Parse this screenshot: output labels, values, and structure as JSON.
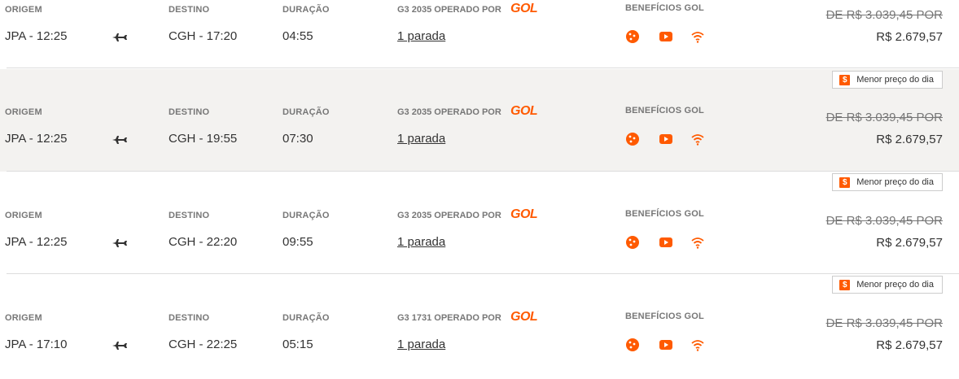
{
  "labels": {
    "origin": "ORIGEM",
    "destination": "DESTINO",
    "duration": "DURAÇÃO",
    "operated_by": "OPERADO POR",
    "benefits": "BENEFÍCIOS GOL",
    "carrier_logo": "GOL"
  },
  "colors": {
    "accent": "#ff5a00",
    "alt_row_bg": "#f3f2f0"
  },
  "icons": [
    "cookie-icon",
    "youtube-icon",
    "wifi-icon",
    "plane-icon",
    "dollar-icon"
  ],
  "flights": [
    {
      "origin": "JPA - 12:25",
      "destination": "CGH - 17:20",
      "duration": "04:55",
      "flight_number": "G3 2035",
      "stops": "1 parada",
      "old_price": "DE R$ 3.039,45 POR",
      "price": "R$ 2.679,57",
      "badge": ""
    },
    {
      "origin": "JPA - 12:25",
      "destination": "CGH - 19:55",
      "duration": "07:30",
      "flight_number": "G3 2035",
      "stops": "1 parada",
      "old_price": "DE R$ 3.039,45 POR",
      "price": "R$ 2.679,57",
      "badge": "Menor preço do dia"
    },
    {
      "origin": "JPA - 12:25",
      "destination": "CGH - 22:20",
      "duration": "09:55",
      "flight_number": "G3 2035",
      "stops": "1 parada",
      "old_price": "DE R$ 3.039,45 POR",
      "price": "R$ 2.679,57",
      "badge": "Menor preço do dia"
    },
    {
      "origin": "JPA - 17:10",
      "destination": "CGH - 22:25",
      "duration": "05:15",
      "flight_number": "G3 1731",
      "stops": "1 parada",
      "old_price": "DE R$ 3.039,45 POR",
      "price": "R$ 2.679,57",
      "badge": "Menor preço do dia"
    }
  ]
}
